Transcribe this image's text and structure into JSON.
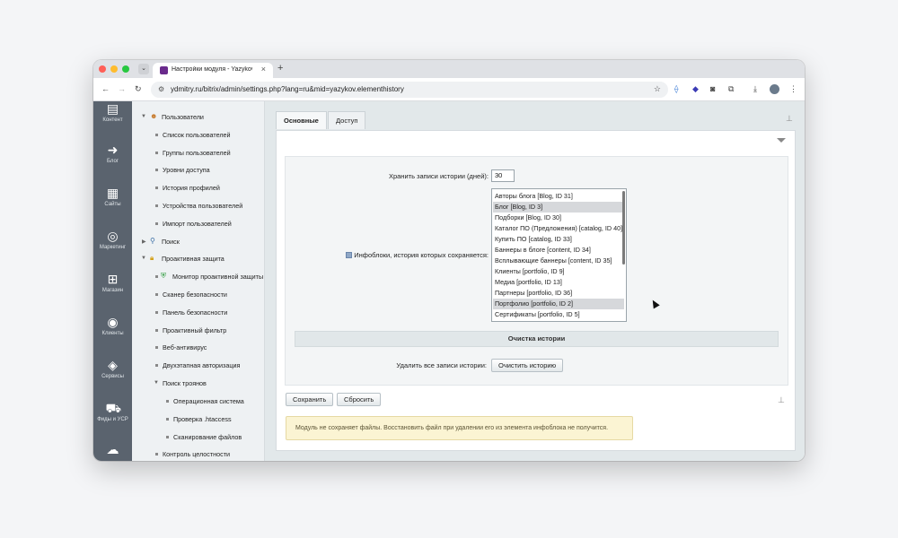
{
  "browser": {
    "tab_title": "Настройки модуля - Yazykov",
    "tab_close": "×",
    "new_tab": "+",
    "url": "ydmitry.ru/bitrix/admin/settings.php?lang=ru&mid=yazykov.elementhistory"
  },
  "rail": {
    "items": [
      {
        "label": "Контент",
        "icon": "document-icon"
      },
      {
        "label": "Блог",
        "icon": "arrow-circle-icon"
      },
      {
        "label": "Сайты",
        "icon": "calendar-icon"
      },
      {
        "label": "Маркетинг",
        "icon": "target-icon"
      },
      {
        "label": "Магазин",
        "icon": "basket-icon"
      },
      {
        "label": "Клиенты",
        "icon": "clients-icon"
      },
      {
        "label": "Сервисы",
        "icon": "layers-icon"
      },
      {
        "label": "Фиды и УСР",
        "icon": "cart-icon"
      }
    ]
  },
  "tree": {
    "items": [
      {
        "label": "Пользователи",
        "level": 0,
        "expanded": true
      },
      {
        "label": "Список пользователей",
        "level": 1
      },
      {
        "label": "Группы пользователей",
        "level": 1
      },
      {
        "label": "Уровни доступа",
        "level": 1
      },
      {
        "label": "История профилей",
        "level": 1
      },
      {
        "label": "Устройства пользователей",
        "level": 1
      },
      {
        "label": "Импорт пользователей",
        "level": 1
      },
      {
        "label": "Поиск",
        "level": 0,
        "expanded": false
      },
      {
        "label": "Проактивная защита",
        "level": 0,
        "expanded": true
      },
      {
        "label": "Монитор проактивной защиты",
        "level": 1
      },
      {
        "label": "Сканер безопасности",
        "level": 1
      },
      {
        "label": "Панель безопасности",
        "level": 1
      },
      {
        "label": "Проактивный фильтр",
        "level": 1
      },
      {
        "label": "Веб-антивирус",
        "level": 1
      },
      {
        "label": "Двухэтапная авторизация",
        "level": 1
      },
      {
        "label": "Поиск троянов",
        "level": 1,
        "expanded": true
      },
      {
        "label": "Операционная система",
        "level": 2
      },
      {
        "label": "Проверка .htaccess",
        "level": 2
      },
      {
        "label": "Сканирование файлов",
        "level": 2
      },
      {
        "label": "Контроль целостности",
        "level": 1
      }
    ]
  },
  "tabs": [
    {
      "label": "Основные",
      "active": true
    },
    {
      "label": "Доступ",
      "active": false
    }
  ],
  "form": {
    "history_days_label": "Хранить записи истории (дней):",
    "history_days_value": "30",
    "iblocks_label": "Инфоблоки, история которых сохраняется:",
    "iblocks": [
      {
        "label": "Авторы блога [Blog, ID 31]",
        "selected": false
      },
      {
        "label": "Блог [Blog, ID 3]",
        "selected": true
      },
      {
        "label": "Подборки [Blog, ID 30]",
        "selected": false
      },
      {
        "label": "Каталог ПО (Предложения) [catalog, ID 40]",
        "selected": false
      },
      {
        "label": "Купить ПО [catalog, ID 33]",
        "selected": false
      },
      {
        "label": "Баннеры в блоге [content, ID 34]",
        "selected": false
      },
      {
        "label": "Всплывающие баннеры [content, ID 35]",
        "selected": false
      },
      {
        "label": "Клиенты [portfolio, ID 9]",
        "selected": false
      },
      {
        "label": "Медиа [portfolio, ID 13]",
        "selected": false
      },
      {
        "label": "Партнеры [portfolio, ID 36]",
        "selected": false
      },
      {
        "label": "Портфолио [portfolio, ID 2]",
        "selected": true
      },
      {
        "label": "Сертификаты [portfolio, ID 5]",
        "selected": false
      }
    ],
    "cleanup_section": "Очистка истории",
    "delete_all_label": "Удалить все записи истории:",
    "clear_button": "Очистить историю"
  },
  "actions": {
    "save": "Сохранить",
    "reset": "Сбросить"
  },
  "notice": "Модуль не сохраняет файлы. Восстановить файл при удалении его из элемента инфоблока не получится."
}
